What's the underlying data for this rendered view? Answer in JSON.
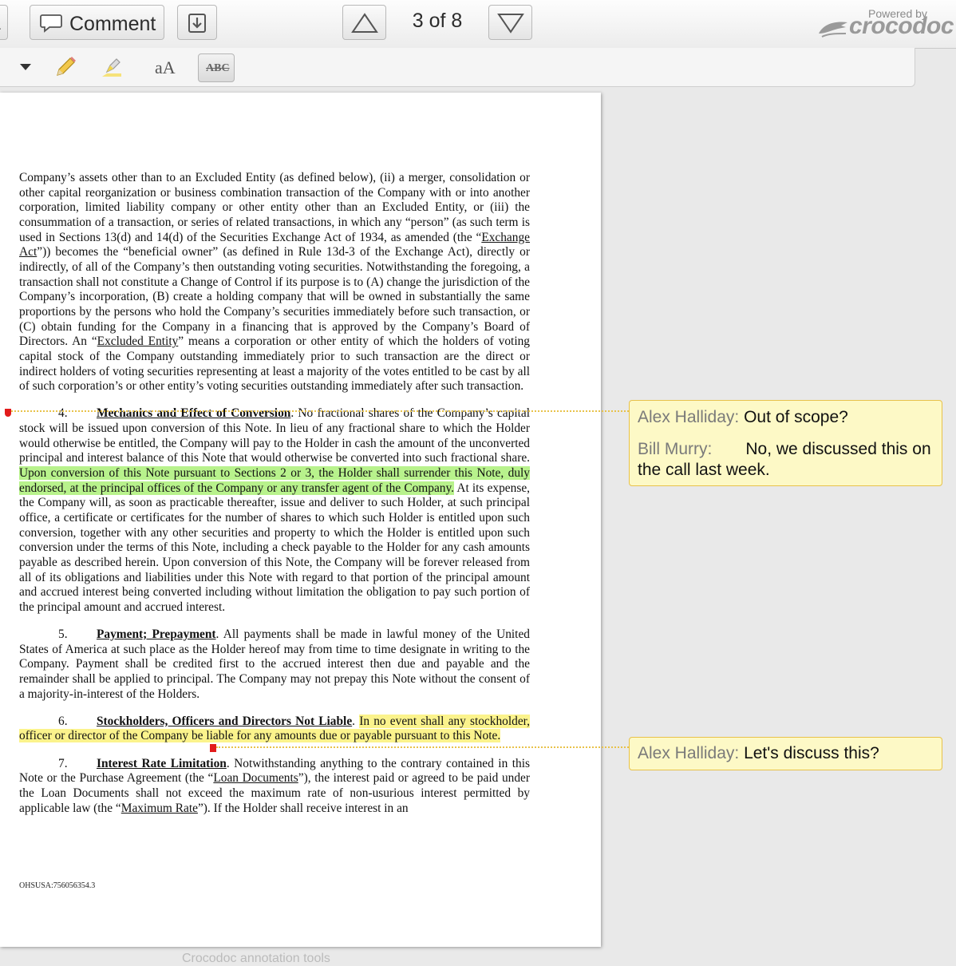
{
  "toolbar": {
    "comment_label": "Comment",
    "page_indicator": "3 of 8",
    "powered_by": "Powered by",
    "brand": "crocodoc",
    "text_size_label": "aA",
    "strike_label": "ABC"
  },
  "document": {
    "para_intro": "Company’s assets other than to an Excluded Entity (as defined below), (ii) a merger, consolidation or other capital reorganization or business combination transaction of the Company with or into another corporation, limited liability company or other entity other than an Excluded Entity, or (iii) the consummation of a transaction, or series of related transactions, in which any “person” (as such term is used in Sections 13(d) and 14(d) of the Securities Exchange Act of 1934, as amended (the “",
    "exchange_act": "Exchange Act",
    "para_intro_2": "”)) becomes the “beneficial owner” (as defined in Rule 13d-3 of the Exchange Act), directly or indirectly, of all of the Company’s then outstanding voting securities.    Notwithstanding the foregoing, a transaction shall not constitute a Change of Control if its purpose is to (A) change the jurisdiction of the Company’s incorporation, (B) create a holding company that will be owned in substantially the same proportions by the persons who hold the Company’s securities immediately before such transaction, or (C) obtain funding for the Company in a financing that is approved by the Company’s Board of Directors.    An “",
    "excluded_entity": "Excluded Entity",
    "para_intro_3": "” means a corporation or other entity of which the holders of voting capital stock of the Company outstanding immediately prior to such transaction are the direct or indirect holders of voting securities representing at least a majority of the votes entitled to be cast by all of such corporation’s or other entity’s voting securities outstanding immediately after such transaction.",
    "s4_num": "4.",
    "s4_head": "Mechanics and Effect of Conversion",
    "s4_a": ".    No fractional shares of the Company’s capital stock will be issued upon conversion of this Note.    In lieu of any fractional share to which the Holder would otherwise be entitled, the Company will pay to the Holder in cash the amount of the unconverted principal and interest balance of this Note that would otherwise be converted into such fractional share.   ",
    "s4_hl": "Upon conversion of this Note pursuant to Sections 2 or 3, the Holder shall surrender this Note, duly endorsed, at the principal offices of the Company or any transfer agent of the Company.",
    "s4_b": "    At its expense, the Company will, as soon as practicable thereafter, issue and deliver to such Holder, at such principal office, a certificate or certificates for the number of shares to which such Holder is entitled upon such conversion, together with any other securities and property to which the Holder is entitled upon such conversion under the terms of this Note, including a check payable to the Holder for any cash amounts payable as described herein.    Upon conversion of this Note, the Company will be forever released from all of its obligations and liabilities under this Note with regard to that portion of the principal amount and accrued interest being converted including without limitation the obligation to pay such portion of the principal amount and accrued interest.",
    "s5_num": "5.",
    "s5_head": "Payment; Prepayment",
    "s5_a": ".    All payments shall be made in lawful money of the United States of America at such place as the Holder hereof may from time to time designate in writing to the Company.    Payment shall be credited first to the accrued interest then due and payable and the remainder shall be applied to principal.    The Company may not prepay this Note without the consent of a majority-in-interest of the Holders.",
    "s6_num": "6.",
    "s6_head": "Stockholders, Officers and Directors Not Liable",
    "s6_dot": ".   ",
    "s6_hl": "In no event shall any stockholder, officer or director of the Company be liable for any amounts due or payable pursuant to this Note.",
    "s7_num": "7.",
    "s7_head": "Interest Rate Limitation",
    "s7_a": ".    Notwithstanding anything to the contrary contained in this Note or the Purchase Agreement (the “",
    "loan_docs": "Loan Documents",
    "s7_b": "”), the interest paid or agreed to be paid under the Loan Documents shall not exceed the maximum rate of non-usurious interest permitted by applicable law (the “",
    "max_rate": "Maximum Rate",
    "s7_c": "”).    If the Holder shall receive interest in an",
    "footer_id": "OHSUSA:756056354.3"
  },
  "comments": [
    {
      "author": "Alex Halliday:",
      "text": "Out of scope?",
      "reply_author": "Bill Murry:",
      "reply_text": "No, we discussed this on the call last week."
    },
    {
      "author": "Alex Halliday:",
      "text": "Let's discuss this?"
    }
  ],
  "colors": {
    "green_highlight": "#b8f28c",
    "yellow_highlight": "#fbf38c",
    "comment_bg": "#fdf9c6",
    "comment_border": "#e8c24a",
    "marker": "#e21b1b"
  },
  "bottom_hint": "Crocodoc annotation tools"
}
